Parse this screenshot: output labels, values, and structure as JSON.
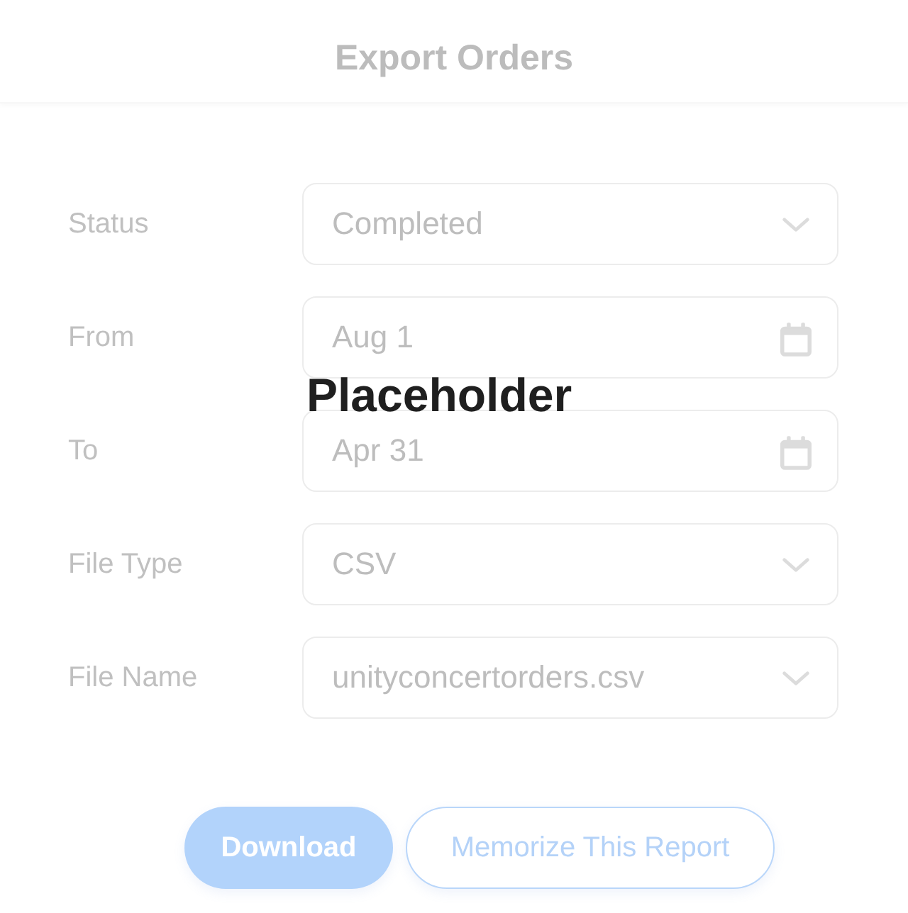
{
  "header": {
    "title": "Export Orders"
  },
  "fields": [
    {
      "label": "Status",
      "kind": "select",
      "value": "Completed"
    },
    {
      "label": "From",
      "kind": "date",
      "value": "Aug 1"
    },
    {
      "label": "To",
      "kind": "date",
      "value": "Apr 31"
    },
    {
      "label": "File Type",
      "kind": "select",
      "value": "CSV"
    },
    {
      "label": "File Name",
      "kind": "select",
      "value": "unityconcertorders.csv"
    }
  ],
  "overlay": {
    "text": "Placeholder"
  },
  "buttons": [
    {
      "label": "Download",
      "kind": "primary"
    },
    {
      "label": "Memorize This Report",
      "kind": "secondary"
    }
  ]
}
